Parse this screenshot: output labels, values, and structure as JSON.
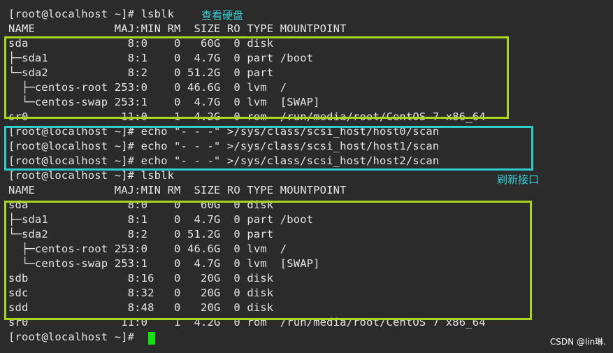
{
  "colors": {
    "background": "#2b2b2b",
    "text": "#e4e4e4",
    "green_box": "#a8d51f",
    "cyan_box": "#2ecccf",
    "annotation": "#38d0d8",
    "cursor": "#14e014"
  },
  "terminal": {
    "lines": [
      "[root@localhost ~]# lsblk",
      "NAME            MAJ:MIN RM  SIZE RO TYPE MOUNTPOINT",
      "sda               8:0    0   60G  0 disk",
      "├─sda1            8:1    0  4.7G  0 part /boot",
      "└─sda2            8:2    0 51.2G  0 part",
      "  ├─centos-root 253:0    0 46.6G  0 lvm  /",
      "  └─centos-swap 253:1    0  4.7G  0 lvm  [SWAP]",
      "sr0              11:0    1  4.2G  0 rom  /run/media/root/CentOS 7 x86_64",
      "[root@localhost ~]# echo \"- - -\" >/sys/class/scsi_host/host0/scan",
      "[root@localhost ~]# echo \"- - -\" >/sys/class/scsi_host/host1/scan",
      "[root@localhost ~]# echo \"- - -\" >/sys/class/scsi_host/host2/scan",
      "[root@localhost ~]# lsblk",
      "NAME            MAJ:MIN RM  SIZE RO TYPE MOUNTPOINT",
      "sda               8:0    0   60G  0 disk",
      "├─sda1            8:1    0  4.7G  0 part /boot",
      "└─sda2            8:2    0 51.2G  0 part",
      "  ├─centos-root 253:0    0 46.6G  0 lvm  /",
      "  └─centos-swap 253:1    0  4.7G  0 lvm  [SWAP]",
      "sdb               8:16   0   20G  0 disk",
      "sdc               8:32   0   20G  0 disk",
      "sdd               8:48   0   20G  0 disk",
      "sr0              11:0    1  4.2G  0 rom  /run/media/root/CentOS 7 x86_64",
      "[root@localhost ~]# "
    ]
  },
  "annotations": {
    "view_disks": "查看硬盘",
    "refresh_interface": "刷新接口"
  },
  "watermark": "CSDN @lin琳."
}
